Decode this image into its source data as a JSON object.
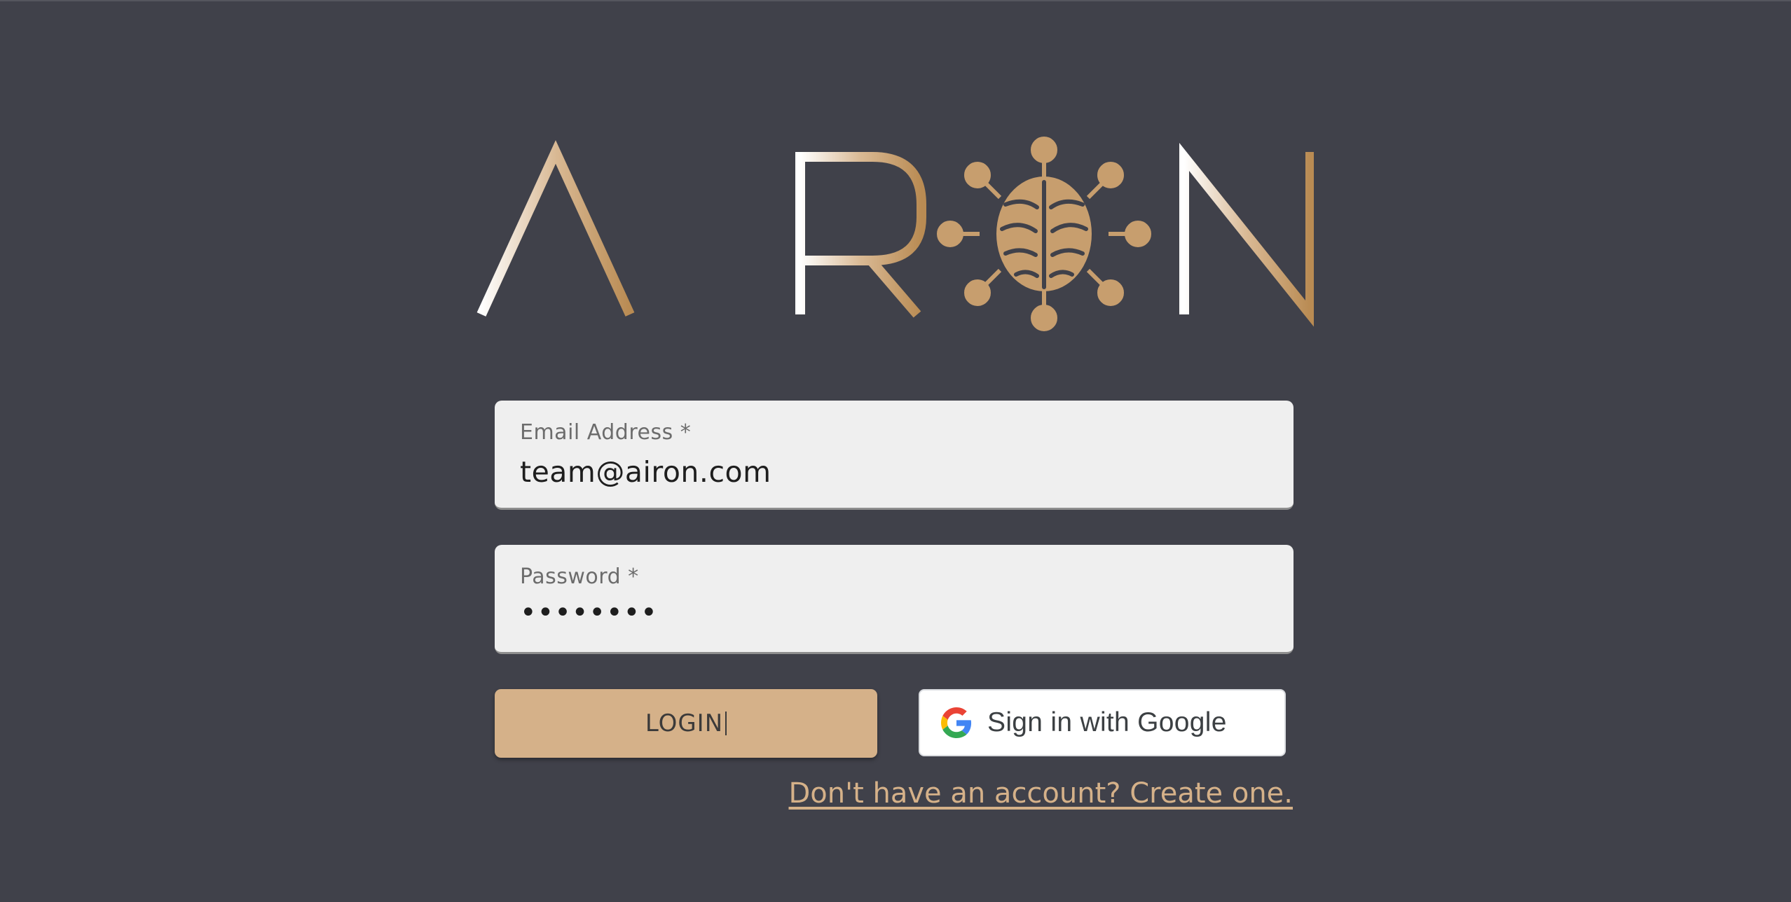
{
  "logo": {
    "text": "AIRON",
    "gradient_start": "#ffffff",
    "gradient_end": "#b98b53",
    "brain_color": "#c79e6e"
  },
  "form": {
    "email": {
      "label": "Email Address *",
      "value": "team@airon.com"
    },
    "password": {
      "label": "Password *",
      "value": "••••••••"
    }
  },
  "actions": {
    "login_label": "LOGIN",
    "google_label": "Sign in with Google",
    "google_icon": "google-g-icon",
    "create_account_link": "Don't have an account? Create one."
  },
  "colors": {
    "background": "#40414a",
    "field_background": "#efefef",
    "login_button": "#d5b189",
    "link": "#d5b189"
  }
}
